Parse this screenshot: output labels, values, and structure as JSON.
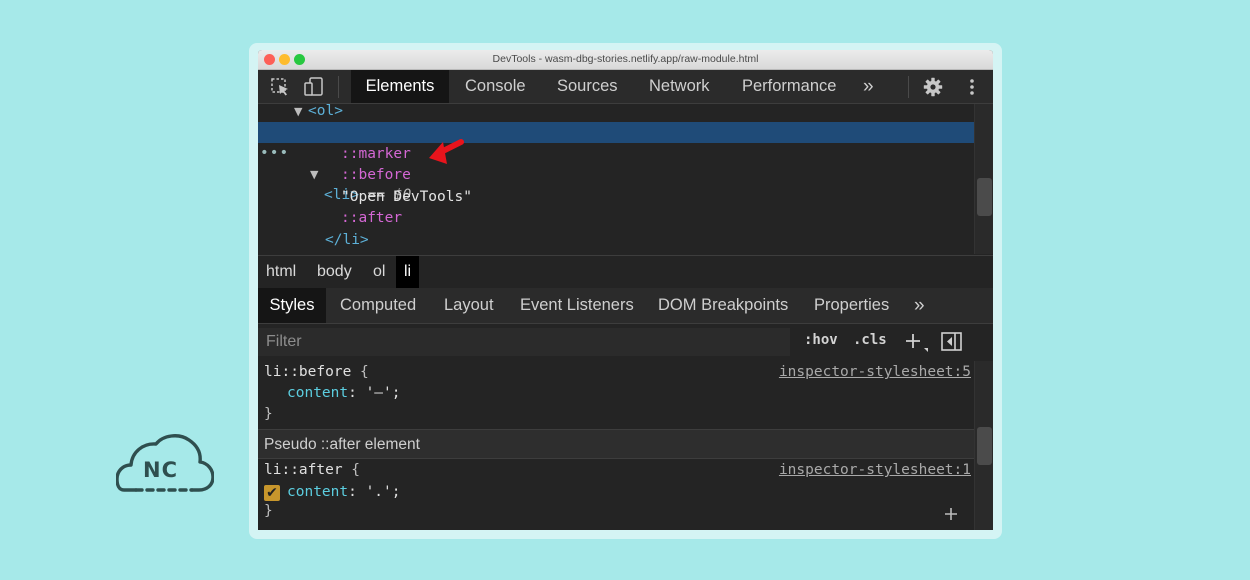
{
  "window": {
    "title": "DevTools - wasm-dbg-stories.netlify.app/raw-module.html"
  },
  "toolbar": {
    "tabs": [
      "Elements",
      "Console",
      "Sources",
      "Network",
      "Performance"
    ],
    "more_label": "»"
  },
  "dom_tree": {
    "ol_open": "<ol>",
    "li_open": "<li>",
    "li_suffix": " == ",
    "dollar": "$0",
    "marker": "::marker",
    "before": "::before",
    "text_node": "\"Open DevTools\"",
    "after": "::after",
    "li_close": "</li>"
  },
  "breadcrumbs": [
    "html",
    "body",
    "ol",
    "li"
  ],
  "subtabs": {
    "items": [
      "Styles",
      "Computed",
      "Layout",
      "Event Listeners",
      "DOM Breakpoints",
      "Properties"
    ],
    "more_label": "»"
  },
  "filter": {
    "placeholder": "Filter",
    "hov": ":hov",
    "cls": ".cls"
  },
  "rules": [
    {
      "selector": "li::before",
      "source": "inspector-stylesheet:5",
      "property": "content",
      "value": "'–';"
    },
    {
      "selector": "li::after",
      "source": "inspector-stylesheet:1",
      "property": "content",
      "value": "'.';"
    }
  ],
  "pseudo_header": "Pseudo ::after element",
  "logo_text": "NC",
  "colors": {
    "background": "#a6e9e9",
    "selected_row": "#1f4b78",
    "pseudo": "#d467d4",
    "tag": "#5db0d7",
    "arrow": "#e8141c"
  }
}
